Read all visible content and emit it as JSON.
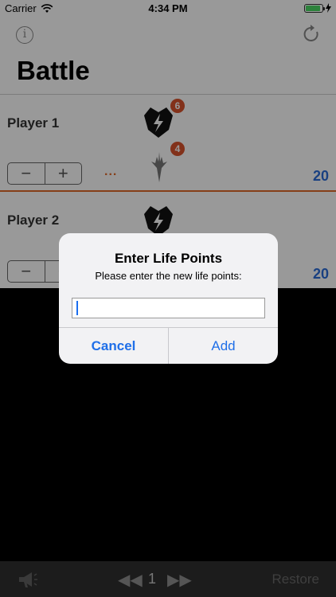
{
  "status": {
    "carrier": "Carrier",
    "time": "4:34 PM",
    "battery_level": 0.9
  },
  "header": {
    "title": "Battle",
    "info_icon": "info-icon",
    "refresh_icon": "refresh-icon"
  },
  "players": [
    {
      "name": "Player 1",
      "life": "20",
      "badge_top": "6",
      "badge_bottom": "4",
      "dots": "..."
    },
    {
      "name": "Player 2",
      "life": "20"
    }
  ],
  "stepper": {
    "minus": "−",
    "plus": "+"
  },
  "dialog": {
    "title": "Enter Life Points",
    "message": "Please enter the new life points:",
    "input_value": "",
    "cancel_label": "Cancel",
    "add_label": "Add"
  },
  "bottom": {
    "page": "1",
    "restore_label": "Restore",
    "rewind_icon": "◀◀",
    "forward_icon": "▶▶"
  },
  "colors": {
    "accent": "#e06a2b",
    "life": "#2b6cd8",
    "badge": "#d9532c",
    "button": "#1f6fe8"
  }
}
